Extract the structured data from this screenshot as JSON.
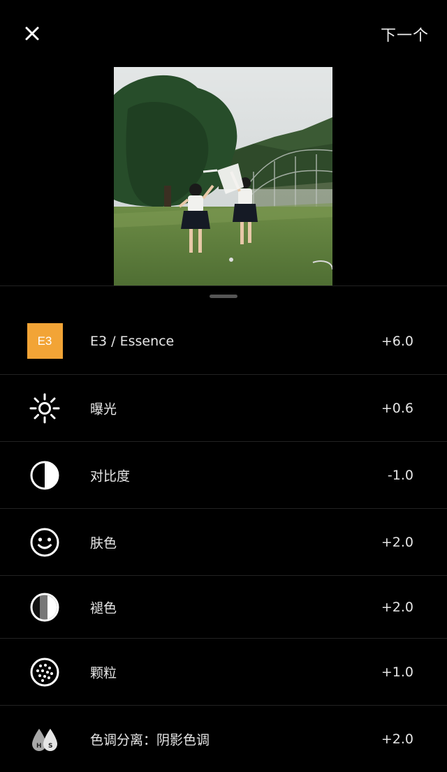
{
  "header": {
    "close_label": "×",
    "next_label": "下一个"
  },
  "tools": [
    {
      "icon": "e3-preset-icon",
      "badge": "E3",
      "label": "E3 / Essence",
      "value": "+6.0"
    },
    {
      "icon": "exposure-sun-icon",
      "label": "曝光",
      "value": "+0.6"
    },
    {
      "icon": "contrast-icon",
      "label": "对比度",
      "value": "-1.0"
    },
    {
      "icon": "skin-tone-face-icon",
      "label": "肤色",
      "value": "+2.0"
    },
    {
      "icon": "fade-icon",
      "label": "褪色",
      "value": "+2.0"
    },
    {
      "icon": "grain-icon",
      "label": "颗粒",
      "value": "+1.0"
    },
    {
      "icon": "split-tone-icon",
      "label": "色调分离：阴影色调",
      "value": "+2.0"
    }
  ],
  "colors": {
    "accent": "#f2a436",
    "background": "#000000",
    "divider": "#222222"
  }
}
